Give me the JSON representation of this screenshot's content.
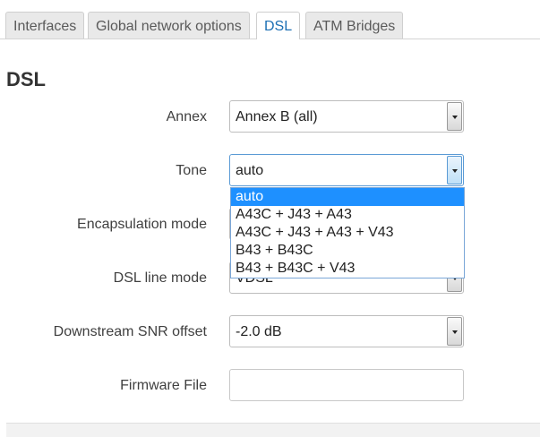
{
  "tabs": [
    {
      "label": "Interfaces"
    },
    {
      "label": "Global network options"
    },
    {
      "label": "DSL",
      "active": true
    },
    {
      "label": "ATM Bridges"
    }
  ],
  "section": {
    "title": "DSL"
  },
  "fields": {
    "annex": {
      "label": "Annex",
      "value": "Annex B (all)"
    },
    "tone": {
      "label": "Tone",
      "value": "auto",
      "options": [
        "auto",
        "A43C + J43 + A43",
        "A43C + J43 + A43 + V43",
        "B43 + B43C",
        "B43 + B43C + V43"
      ]
    },
    "encapsulation": {
      "label": "Encapsulation mode"
    },
    "line_mode": {
      "label": "DSL line mode",
      "value": "VDSL"
    },
    "snr_offset": {
      "label": "Downstream SNR offset",
      "value": "-2.0 dB"
    },
    "firmware": {
      "label": "Firmware File",
      "value": ""
    }
  },
  "colors": {
    "active_tab": "#1c6fb4",
    "selected_option": "#1e90ff"
  }
}
